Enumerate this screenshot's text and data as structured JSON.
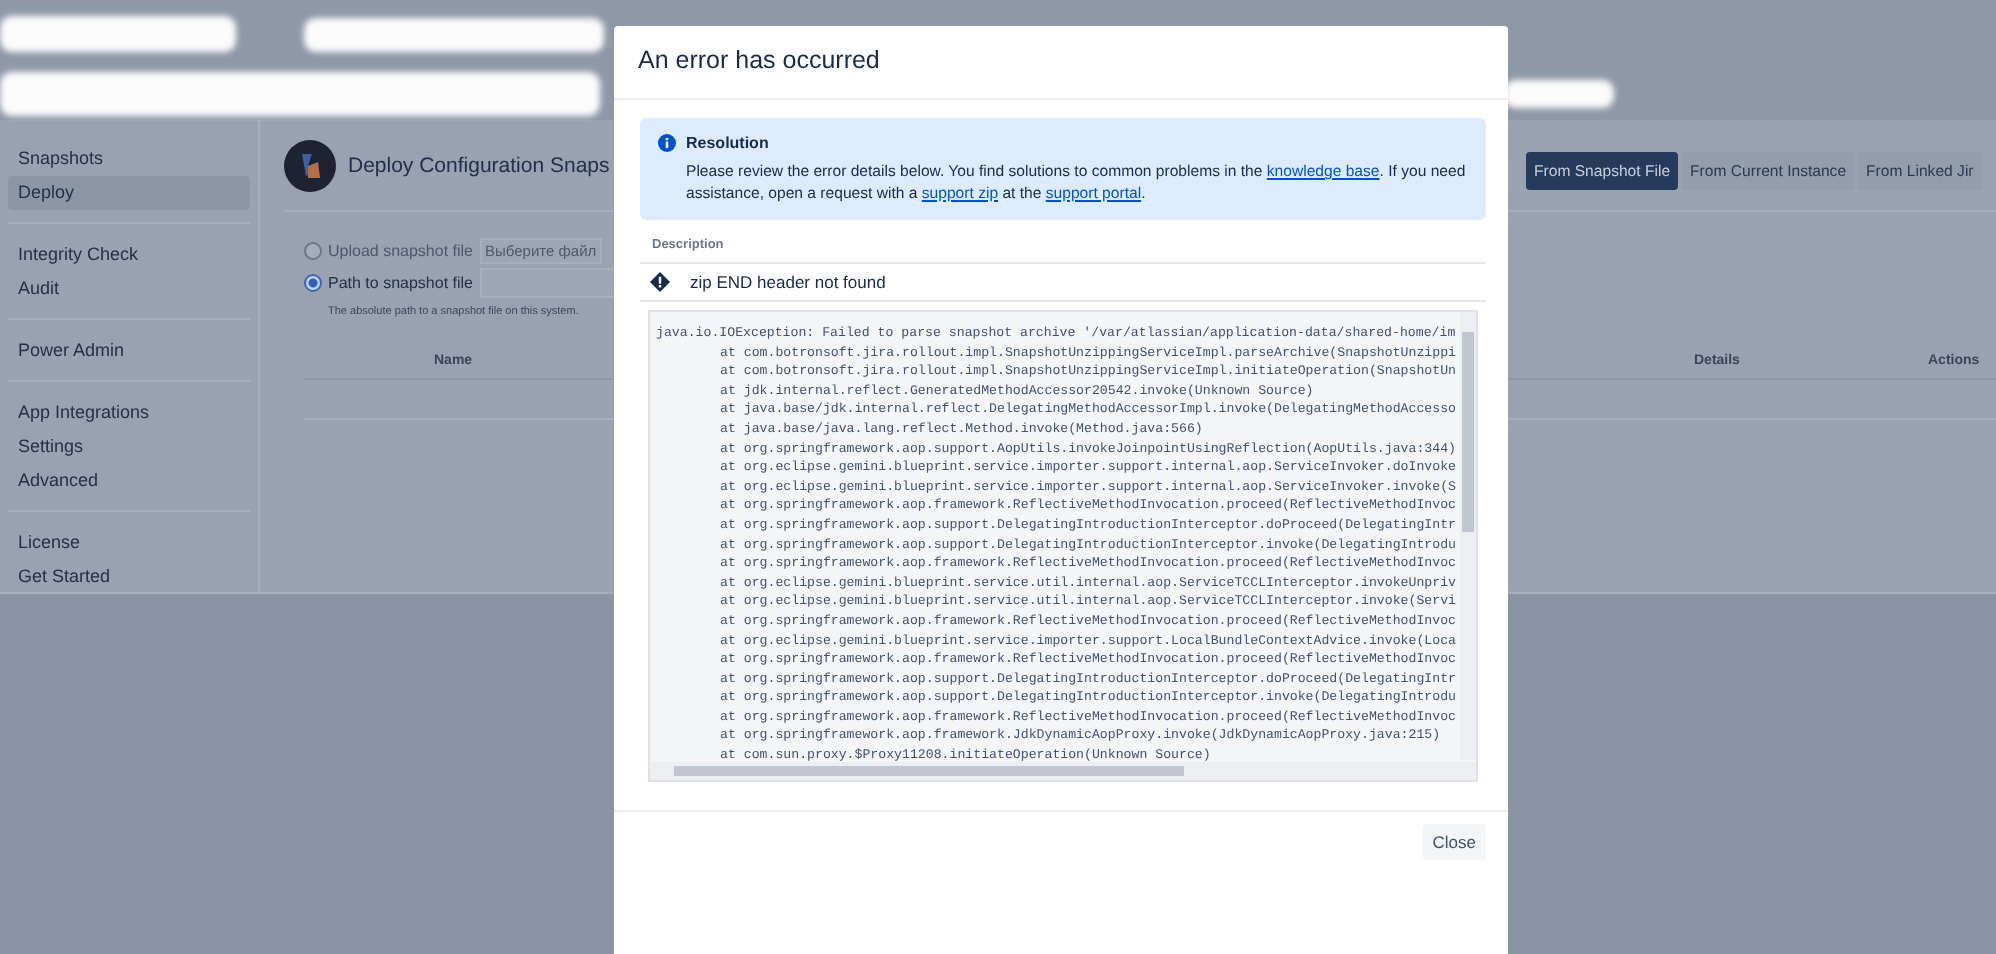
{
  "sidebar": {
    "groups": [
      {
        "items": [
          {
            "label": "Snapshots",
            "selected": false
          },
          {
            "label": "Deploy",
            "selected": true
          }
        ]
      },
      {
        "items": [
          {
            "label": "Integrity Check",
            "selected": false
          },
          {
            "label": "Audit",
            "selected": false
          }
        ]
      },
      {
        "items": [
          {
            "label": "Power Admin",
            "selected": false
          }
        ]
      },
      {
        "items": [
          {
            "label": "App Integrations",
            "selected": false
          },
          {
            "label": "Settings",
            "selected": false
          },
          {
            "label": "Advanced",
            "selected": false
          }
        ]
      },
      {
        "items": [
          {
            "label": "License",
            "selected": false
          },
          {
            "label": "Get Started",
            "selected": false
          }
        ]
      }
    ]
  },
  "page": {
    "title": "Deploy Configuration Snaps",
    "tabs": [
      {
        "label": "From Snapshot File",
        "selected": true
      },
      {
        "label": "From Current Instance",
        "selected": false
      },
      {
        "label": "From Linked Jir",
        "selected": false
      }
    ],
    "source_options": [
      {
        "label": "Upload snapshot file",
        "selected": false,
        "kind": "upload",
        "button": "Выберите файл"
      },
      {
        "label": "Path to snapshot file",
        "selected": true,
        "kind": "path"
      }
    ],
    "path_hint": "The absolute path to a snapshot file on this system.",
    "table": {
      "columns": [
        "Name",
        "Details",
        "Actions"
      ]
    }
  },
  "dialog": {
    "title": "An error has occurred",
    "resolution": {
      "title": "Resolution",
      "text": [
        {
          "kind": "text",
          "text": "Please review the error details below. You find solutions to common problems in the "
        },
        {
          "kind": "link",
          "text": "knowledge base"
        },
        {
          "kind": "text",
          "text": ". If you need assistance, open a request with a "
        },
        {
          "kind": "link",
          "text": "support zip"
        },
        {
          "kind": "text",
          "text": " at the "
        },
        {
          "kind": "link",
          "text": "support portal"
        },
        {
          "kind": "text",
          "text": "."
        }
      ]
    },
    "description_label": "Description",
    "error_message": "zip END header not found",
    "stack_trace": [
      {
        "kind": "message",
        "text": "java.io.IOException: Failed to parse snapshot archive '/var/atlassian/application-data/shared-home/im"
      },
      {
        "kind": "frame",
        "text": "at com.botronsoft.jira.rollout.impl.SnapshotUnzippingServiceImpl.parseArchive(SnapshotUnzippi"
      },
      {
        "kind": "frame",
        "text": "at com.botronsoft.jira.rollout.impl.SnapshotUnzippingServiceImpl.initiateOperation(SnapshotUn"
      },
      {
        "kind": "frame",
        "text": "at jdk.internal.reflect.GeneratedMethodAccessor20542.invoke(Unknown Source)"
      },
      {
        "kind": "frame",
        "text": "at java.base/jdk.internal.reflect.DelegatingMethodAccessorImpl.invoke(DelegatingMethodAccesso"
      },
      {
        "kind": "frame",
        "text": "at java.base/java.lang.reflect.Method.invoke(Method.java:566)"
      },
      {
        "kind": "frame",
        "text": "at org.springframework.aop.support.AopUtils.invokeJoinpointUsingReflection(AopUtils.java:344)"
      },
      {
        "kind": "frame",
        "text": "at org.eclipse.gemini.blueprint.service.importer.support.internal.aop.ServiceInvoker.doInvoke"
      },
      {
        "kind": "frame",
        "text": "at org.eclipse.gemini.blueprint.service.importer.support.internal.aop.ServiceInvoker.invoke(S"
      },
      {
        "kind": "frame",
        "text": "at org.springframework.aop.framework.ReflectiveMethodInvocation.proceed(ReflectiveMethodInvoc"
      },
      {
        "kind": "frame",
        "text": "at org.springframework.aop.support.DelegatingIntroductionInterceptor.doProceed(DelegatingIntr"
      },
      {
        "kind": "frame",
        "text": "at org.springframework.aop.support.DelegatingIntroductionInterceptor.invoke(DelegatingIntrodu"
      },
      {
        "kind": "frame",
        "text": "at org.springframework.aop.framework.ReflectiveMethodInvocation.proceed(ReflectiveMethodInvoc"
      },
      {
        "kind": "frame",
        "text": "at org.eclipse.gemini.blueprint.service.util.internal.aop.ServiceTCCLInterceptor.invokeUnpriv"
      },
      {
        "kind": "frame",
        "text": "at org.eclipse.gemini.blueprint.service.util.internal.aop.ServiceTCCLInterceptor.invoke(Servi"
      },
      {
        "kind": "frame",
        "text": "at org.springframework.aop.framework.ReflectiveMethodInvocation.proceed(ReflectiveMethodInvoc"
      },
      {
        "kind": "frame",
        "text": "at org.eclipse.gemini.blueprint.service.importer.support.LocalBundleContextAdvice.invoke(Loca"
      },
      {
        "kind": "frame",
        "text": "at org.springframework.aop.framework.ReflectiveMethodInvocation.proceed(ReflectiveMethodInvoc"
      },
      {
        "kind": "frame",
        "text": "at org.springframework.aop.support.DelegatingIntroductionInterceptor.doProceed(DelegatingIntr"
      },
      {
        "kind": "frame",
        "text": "at org.springframework.aop.support.DelegatingIntroductionInterceptor.invoke(DelegatingIntrodu"
      },
      {
        "kind": "frame",
        "text": "at org.springframework.aop.framework.ReflectiveMethodInvocation.proceed(ReflectiveMethodInvoc"
      },
      {
        "kind": "frame",
        "text": "at org.springframework.aop.framework.JdkDynamicAopProxy.invoke(JdkDynamicAopProxy.java:215)"
      },
      {
        "kind": "frame",
        "text": "at com.sun.proxy.$Proxy11208.initiateOperation(Unknown Source)"
      }
    ],
    "close_button": "Close"
  }
}
